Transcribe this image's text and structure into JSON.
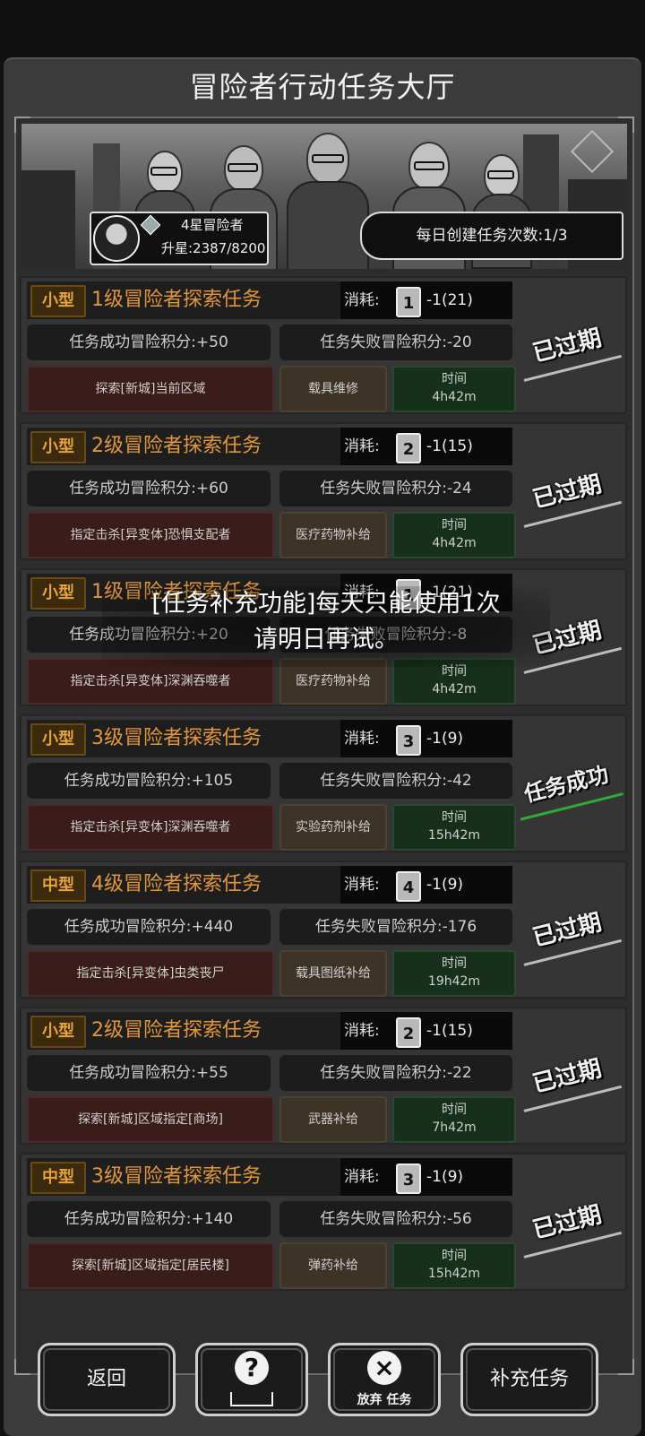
{
  "title": "冒险者行动任务大厅",
  "player": {
    "rank": "4星冒险者",
    "upgrade": "升星:2387/8200"
  },
  "daily_create": "每日创建任务次数:1/3",
  "cost_label": "消耗:",
  "time_label": "时间",
  "tasks": [
    {
      "size": "小型",
      "name": "1级冒险者探索任务",
      "level": "1",
      "cost": "-1(21)",
      "success": "任务成功冒险积分:+50",
      "fail": "任务失败冒险积分:-20",
      "objective": "探索[新城]当前区域",
      "supply": "载具维修",
      "time": "4h42m",
      "status": "已过期"
    },
    {
      "size": "小型",
      "name": "2级冒险者探索任务",
      "level": "2",
      "cost": "-1(15)",
      "success": "任务成功冒险积分:+60",
      "fail": "任务失败冒险积分:-24",
      "objective": "指定击杀[异变体]恐惧支配者",
      "supply": "医疗药物补给",
      "time": "4h42m",
      "status": "已过期"
    },
    {
      "size": "小型",
      "name": "1级冒险者探索任务",
      "level": "1",
      "cost": "-1(21)",
      "success": "任务成功冒险积分:+20",
      "fail": "任务失败冒险积分:-8",
      "objective": "指定击杀[异变体]深渊吞噬者",
      "supply": "医疗药物补给",
      "time": "4h42m",
      "status": "已过期"
    },
    {
      "size": "小型",
      "name": "3级冒险者探索任务",
      "level": "3",
      "cost": "-1(9)",
      "success": "任务成功冒险积分:+105",
      "fail": "任务失败冒险积分:-42",
      "objective": "指定击杀[异变体]深渊吞噬者",
      "supply": "实验药剂补给",
      "time": "15h42m",
      "status": "任务成功"
    },
    {
      "size": "中型",
      "name": "4级冒险者探索任务",
      "level": "4",
      "cost": "-1(9)",
      "success": "任务成功冒险积分:+440",
      "fail": "任务失败冒险积分:-176",
      "objective": "指定击杀[异变体]虫类丧尸",
      "supply": "载具图纸补给",
      "time": "19h42m",
      "status": "已过期"
    },
    {
      "size": "小型",
      "name": "2级冒险者探索任务",
      "level": "2",
      "cost": "-1(15)",
      "success": "任务成功冒险积分:+55",
      "fail": "任务失败冒险积分:-22",
      "objective": "探索[新城]区域指定[商场]",
      "supply": "武器补给",
      "time": "7h42m",
      "status": "已过期"
    },
    {
      "size": "中型",
      "name": "3级冒险者探索任务",
      "level": "3",
      "cost": "-1(9)",
      "success": "任务成功冒险积分:+140",
      "fail": "任务失败冒险积分:-56",
      "objective": "探索[新城]区域指定[居民楼]",
      "supply": "弹药补给",
      "time": "15h42m",
      "status": "已过期"
    }
  ],
  "toast": {
    "line1": "[任务补充功能]每天只能使用1次",
    "line2": "请明日再试。"
  },
  "buttons": {
    "back": "返回",
    "help_icon": "?",
    "abandon_icon": "×",
    "abandon": "放弃 任务",
    "refill": "补充任务"
  },
  "icons": {
    "avatar": "avatar",
    "rank_gem": "gem-icon",
    "help": "question-icon",
    "abandon": "close-icon"
  }
}
